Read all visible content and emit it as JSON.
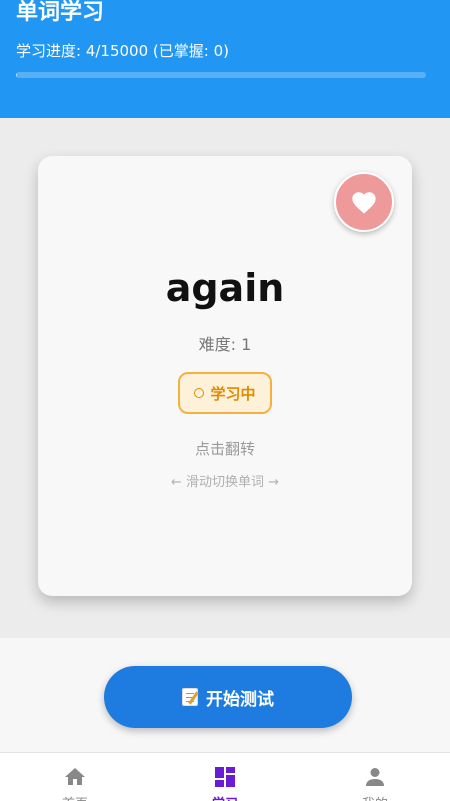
{
  "header": {
    "title": "单词学习",
    "progress_text": "学习进度: 4/15000 (已掌握: 0)",
    "progress_fraction": 0.0003
  },
  "card": {
    "word": "again",
    "difficulty_label": "难度: ",
    "difficulty_value": "1",
    "status_label": "学习中",
    "flip_hint": "点击翻转",
    "swipe_hint": "← 滑动切换单词 →",
    "favorite_icon": "heart-icon"
  },
  "actions": {
    "start_test_label": "开始测试",
    "start_test_icon": "memo-icon"
  },
  "tabbar": {
    "tabs": [
      {
        "label": "首页",
        "icon": "home-icon",
        "active": false
      },
      {
        "label": "学习",
        "icon": "grid-icon",
        "active": true
      },
      {
        "label": "我的",
        "icon": "user-icon",
        "active": false
      }
    ]
  },
  "colors": {
    "header": "#2196f3",
    "button": "#1e7ce0",
    "status_accent": "#e08a00",
    "favorite": "#ef9a9a",
    "active_tab": "#6a1bd6"
  }
}
